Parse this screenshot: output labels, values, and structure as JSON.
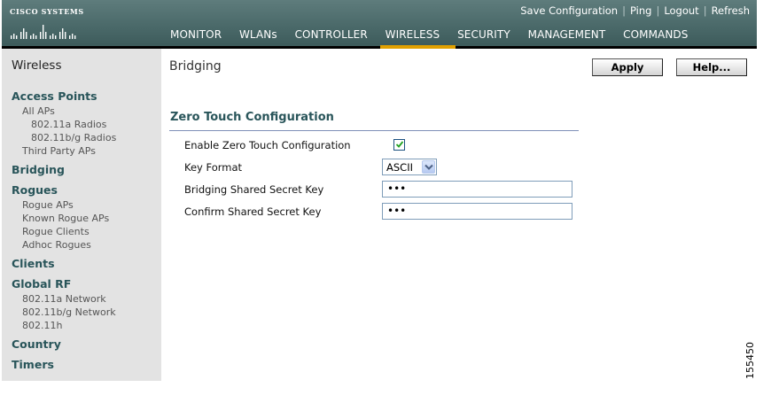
{
  "logo": {
    "text": "Cisco Systems"
  },
  "top_links": [
    "Save Configuration",
    "Ping",
    "Logout",
    "Refresh"
  ],
  "main_nav": {
    "items": [
      "MONITOR",
      "WLANs",
      "CONTROLLER",
      "WIRELESS",
      "SECURITY",
      "MANAGEMENT",
      "COMMANDS"
    ],
    "active": "WIRELESS"
  },
  "sidebar": {
    "title": "Wireless",
    "access_points": {
      "label": "Access Points",
      "all_aps": "All APs",
      "radios_a": "802.11a Radios",
      "radios_bg": "802.11b/g Radios",
      "third_party": "Third Party APs"
    },
    "bridging": "Bridging",
    "rogues": {
      "label": "Rogues",
      "rogue_aps": "Rogue APs",
      "known_rogue_aps": "Known Rogue APs",
      "rogue_clients": "Rogue Clients",
      "adhoc_rogues": "Adhoc Rogues"
    },
    "clients": "Clients",
    "global_rf": {
      "label": "Global RF",
      "net_a": "802.11a Network",
      "net_bg": "802.11b/g Network",
      "h": "802.11h"
    },
    "country": "Country",
    "timers": "Timers"
  },
  "page": {
    "title": "Bridging",
    "apply_label": "Apply",
    "help_label": "Help...",
    "section_title": "Zero Touch Configuration"
  },
  "form": {
    "enable_label": "Enable Zero Touch Configuration",
    "enable_checked": true,
    "key_format_label": "Key Format",
    "key_format_value": "ASCII",
    "shared_secret_label": "Bridging Shared Secret Key",
    "shared_secret_value": "•••",
    "confirm_secret_label": "Confirm Shared Secret Key",
    "confirm_secret_value": "•••"
  },
  "figure_id": "155450",
  "colors": {
    "header": "#4b6a6a",
    "active_tab_accent": "#e0a000",
    "section_heading": "#29555a",
    "sidebar_bg": "#e3e3e3"
  }
}
